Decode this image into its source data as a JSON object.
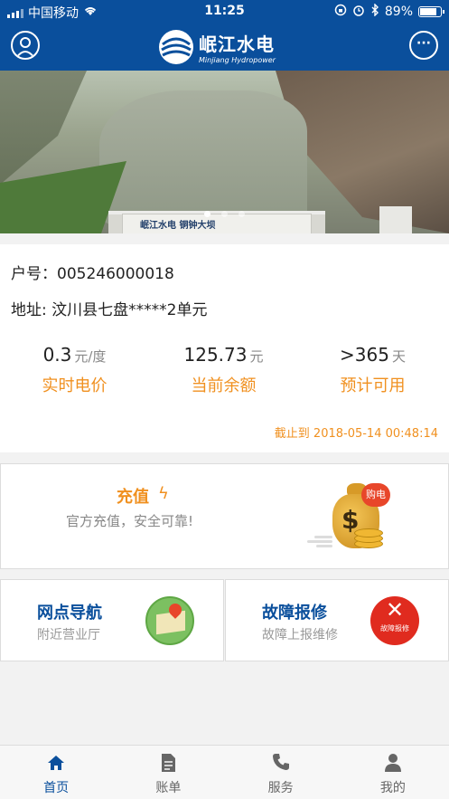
{
  "status_bar": {
    "carrier": "中国移动",
    "time": "11:25",
    "battery": "89%",
    "battery_level": 0.89
  },
  "header": {
    "logo_cn": "岷江水电",
    "logo_en": "Minjiang Hydropower"
  },
  "banner": {
    "dam_label": "岷江水电 铜钟大坝",
    "slides_count": 3,
    "active_slide": 1
  },
  "account": {
    "account_label": "户号：",
    "account_number": "005246000018",
    "address_label": "地址: ",
    "address": "汶川县七盘*****2单元",
    "stats": [
      {
        "value": "0.3",
        "unit": "元/度",
        "label": "实时电价"
      },
      {
        "value": "125.73",
        "unit": "元",
        "label": "当前余额"
      },
      {
        "value": ">365",
        "unit": "天",
        "label": "预计可用"
      }
    ],
    "as_of": "截止到 2018-05-14 00:48:14"
  },
  "recharge": {
    "title": "充值",
    "subtitle": "官方充值，安全可靠!",
    "badge": "购电"
  },
  "tiles": [
    {
      "title": "网点导航",
      "subtitle": "附近营业厅",
      "icon": "map-icon"
    },
    {
      "title": "故障报修",
      "subtitle": "故障上报维修",
      "icon": "tools-icon",
      "icon_caption": "故障报修"
    }
  ],
  "tabbar": [
    {
      "label": "首页",
      "icon": "home-icon",
      "active": true
    },
    {
      "label": "账单",
      "icon": "bill-icon",
      "active": false
    },
    {
      "label": "服务",
      "icon": "phone-icon",
      "active": false
    },
    {
      "label": "我的",
      "icon": "person-icon",
      "active": false
    }
  ],
  "colors": {
    "brand_blue": "#0a4f9c",
    "accent_orange": "#f0901f",
    "alert_red": "#e02b1f"
  }
}
